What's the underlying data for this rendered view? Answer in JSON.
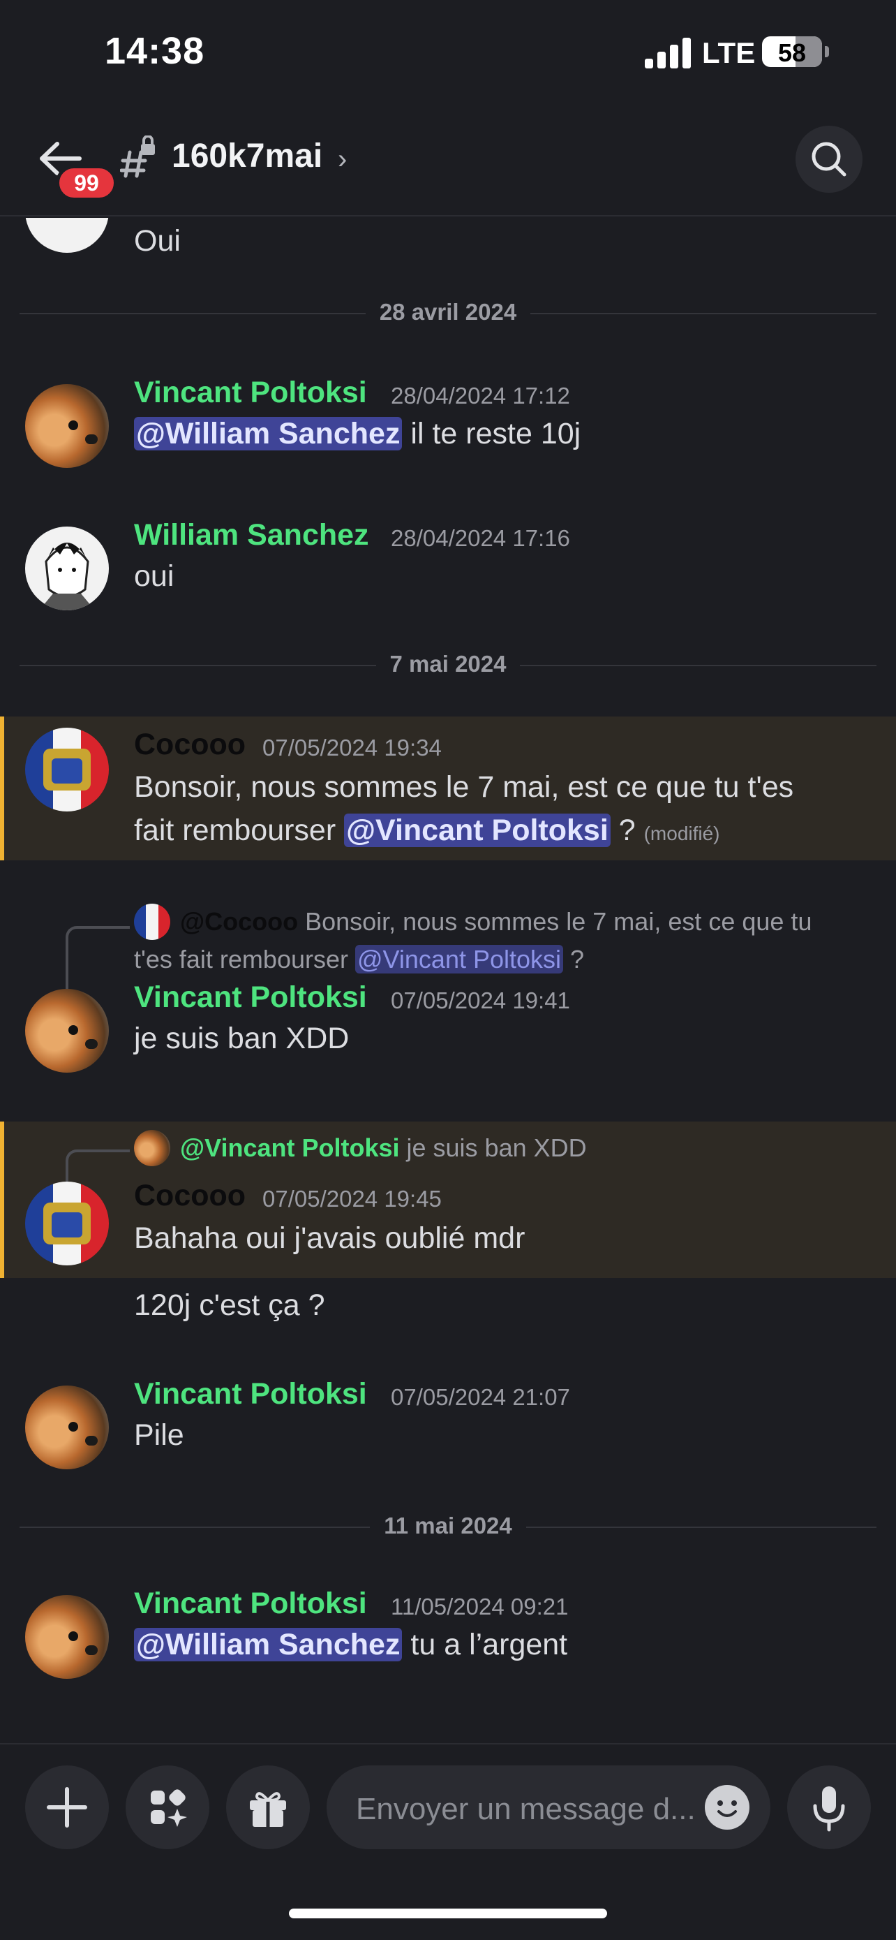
{
  "status_bar": {
    "time": "14:38",
    "network": "LTE",
    "battery": "58"
  },
  "header": {
    "unread_badge": "99",
    "channel_name": "160k7mai",
    "chevron": "›"
  },
  "messages": {
    "prev": {
      "text": "Oui"
    },
    "divider1": "28 avril 2024",
    "m1": {
      "author": "Vincant Poltoksi",
      "timestamp": "28/04/2024 17:12",
      "mention": "@William Sanchez",
      "text": " il te reste 10j"
    },
    "m2": {
      "author": "William Sanchez",
      "timestamp": "28/04/2024 17:16",
      "text": "oui"
    },
    "divider2": "7 mai 2024",
    "m3": {
      "author": "Cocooo",
      "timestamp": "07/05/2024 19:34",
      "line1": "Bonsoir, nous sommes le 7 mai, est ce que tu t'es",
      "line2_text": "fait rembourser ",
      "mention": "@Vincant Poltoksi",
      "line2_tail": " ? ",
      "edited": "(modifié)"
    },
    "m4": {
      "reply": {
        "author": "@Cocooo",
        "text1": " Bonsoir, nous sommes le 7 mai, est ce que tu",
        "text2": "t'es fait rembourser ",
        "mention": "@Vincant Poltoksi",
        "tail": " ?"
      },
      "author": "Vincant Poltoksi",
      "timestamp": "07/05/2024 19:41",
      "text": "je suis ban XDD"
    },
    "m5": {
      "reply": {
        "author": "@Vincant Poltoksi",
        "text": " je suis ban XDD"
      },
      "author": "Cocooo",
      "timestamp": "07/05/2024 19:45",
      "text": "Bahaha oui j'avais oublié mdr",
      "text2": "120j c'est ça ?"
    },
    "m6": {
      "author": "Vincant Poltoksi",
      "timestamp": "07/05/2024 21:07",
      "text": "Pile"
    },
    "divider3": "11 mai 2024",
    "m7": {
      "author": "Vincant Poltoksi",
      "timestamp": "11/05/2024 09:21",
      "mention": "@William Sanchez",
      "text": " tu a l’argent"
    }
  },
  "composer": {
    "placeholder": "Envoyer un message d..."
  },
  "colors": {
    "background": "#1c1d22",
    "username_green": "#4ee47f",
    "mention_bg": "#3f4497",
    "highlight_bar": "#f0b232",
    "badge_red": "#e5353d"
  }
}
